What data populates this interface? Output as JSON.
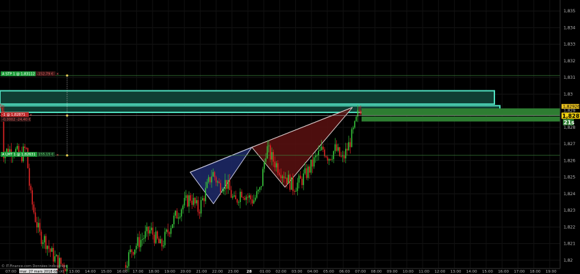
{
  "chart_data": {
    "type": "candlestick",
    "instrument_note": "",
    "y_axis": {
      "ticks": [
        "1,835",
        "1,834",
        "1,833",
        "1,832",
        "1,831",
        "1,83",
        "1,829",
        "1,828",
        "1,827",
        "1,826",
        "1,825",
        "1,824",
        "1,823",
        "1,822",
        "1,821",
        "1,82"
      ],
      "ylim": [
        1.8195,
        1.8355
      ],
      "current_price": "1,8287",
      "current_sub": "21s",
      "top_marker": "1,82926"
    },
    "x_axis": {
      "ticks": [
        "07:00",
        "09:00",
        "11:00",
        "12:00",
        "13:00",
        "14:00",
        "15:00",
        "16:00",
        "17:00",
        "18:00",
        "19:00",
        "20:00",
        "21:00",
        "22:00",
        "23:00",
        "28",
        "01:00",
        "02:00",
        "03:00",
        "04:00",
        "05:00",
        "06:00",
        "07:00",
        "08:00",
        "09:00",
        "10:00",
        "11:00",
        "12:00",
        "13:00",
        "14:00",
        "15:00",
        "16:00",
        "17:00",
        "18:00",
        "19:00"
      ],
      "cursor_label": "mar. 27 mars 2018 08:50"
    },
    "orders": {
      "stop": {
        "label": "A STP 1 @ 1,83112",
        "value": "-152,79 €",
        "price": 1.83112
      },
      "position": {
        "label": "-1 @ 1,82871",
        "value_pips": "-0,00029",
        "value_eur": "-24,40 €",
        "price": 1.82871
      },
      "limit": {
        "label": "A LMT 1 @ 1,82631",
        "value": "155,15 €",
        "price": 1.82631
      }
    },
    "zones": [
      {
        "name": "resistance-upper",
        "y_top": 1.8302,
        "y_bottom": 1.8294
      },
      {
        "name": "resistance-lower",
        "y_top": 1.8293,
        "y_bottom": 1.8289
      },
      {
        "name": "target",
        "y_top": 1.82914,
        "y_bottom": 1.82835
      }
    ],
    "pattern": {
      "points": [
        {
          "t": "20:22",
          "y": 1.8253
        },
        {
          "t": "21:50",
          "y": 1.8234
        },
        {
          "t": "00:15",
          "y": 1.8268
        },
        {
          "t": "02:20",
          "y": 1.8244
        },
        {
          "t": "06:35",
          "y": 1.8292
        }
      ]
    },
    "colors": {
      "up": "#36c33a",
      "down": "#e02424",
      "background": "#000000"
    }
  },
  "footer": {
    "copyright": "© IT-Finance.com Données indicatives"
  }
}
